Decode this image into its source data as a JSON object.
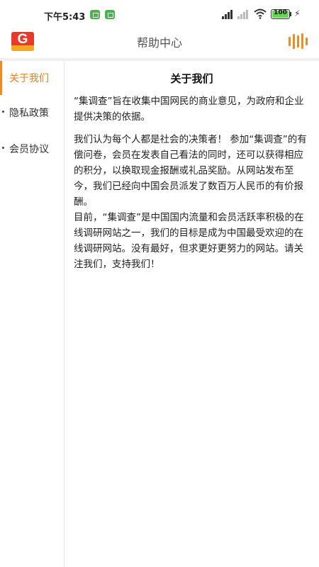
{
  "status_bar": {
    "time": "下午5:43",
    "battery": "100"
  },
  "header": {
    "title": "帮助中心"
  },
  "sidebar": {
    "items": [
      {
        "label": "关于我们",
        "active": true
      },
      {
        "label": "隐私政策",
        "active": false
      },
      {
        "label": "会员协议",
        "active": false
      }
    ]
  },
  "content": {
    "title": "关于我们",
    "paragraphs": [
      "“集调查”旨在收集中国网民的商业意见，为政府和企业提供决策的依据。",
      "我们认为每个人都是社会的决策者！ 参加“集调查”的有偿问卷，会员在发表自己看法的同时，还可以获得相应的积分，以换取现金报酬或礼品奖励。从网站发布至今，我们已经向中国会员派发了数百万人民币的有价报酬。",
      "目前，“集调查”是中国国内流量和会员活跃率积极的在线调研网站之一，我们的目标是成为中国最受欢迎的在线调研网站。没有最好，但求更好更努力的网站。请关注我们，支持我们！"
    ]
  },
  "colors": {
    "accent": "#f08a24",
    "active_text": "#e67e22",
    "logo_red": "#e8392c",
    "battery_green": "#6bd15a",
    "notification_green": "#4caf50"
  },
  "icons": {
    "logo": "app-logo",
    "menu": "audio-bars-icon",
    "signal": "signal-icon",
    "wifi": "wifi-icon",
    "battery": "battery-icon",
    "charging": "charging-bolt-icon"
  }
}
